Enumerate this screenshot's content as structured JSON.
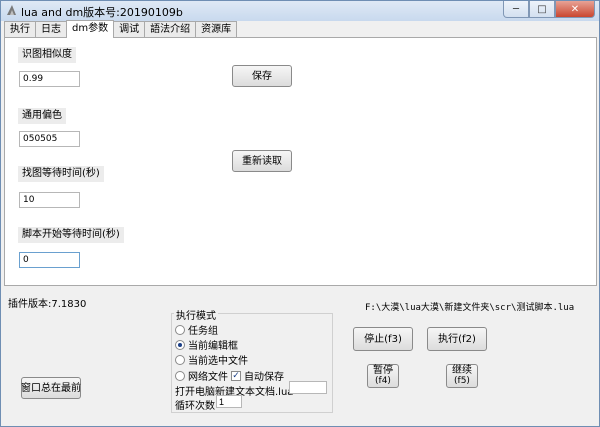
{
  "window": {
    "title": "lua and dm版本号:20190109b",
    "min_glyph": "─",
    "max_glyph": "□",
    "close_glyph": "✕"
  },
  "tabs": [
    {
      "label": "执行",
      "active": false
    },
    {
      "label": "日志",
      "active": false
    },
    {
      "label": "dm参数",
      "active": true
    },
    {
      "label": "调试",
      "active": false
    },
    {
      "label": "語法介绍",
      "active": false
    },
    {
      "label": "资源库",
      "active": false
    }
  ],
  "params": {
    "similarity_label": "识图相似度",
    "similarity_value": "0.99",
    "color_offset_label": "通用偏色",
    "color_offset_value": "050505",
    "find_wait_label": "找图等待时间(秒)",
    "find_wait_value": "10",
    "start_wait_label": "脚本开始等待时间(秒)",
    "start_wait_value": "0",
    "save_button": "保存",
    "reload_button": "重新读取"
  },
  "footer": {
    "plugin_version": "插件版本:7.1830",
    "script_path": "F:\\大漠\\lua大漠\\新建文件夹\\scr\\测试脚本.lua",
    "always_on_top_button": "窗口总在最前",
    "exec_mode_legend": "执行模式",
    "mode_task_group": "任务组",
    "mode_current_editor": "当前编辑框",
    "mode_current_file": "当前选中文件",
    "mode_web_file": "网络文件",
    "auto_save": "自动保存",
    "open_new_file_label": "打开电脑新建文本文档.lua",
    "open_new_file_value": "",
    "loop_count_label": "循环次数",
    "loop_count_value": "1",
    "stop_button": "停止(f3)",
    "run_button": "执行(f2)",
    "pause_label": "暂停",
    "pause_key": "(f4)",
    "resume_label": "继续",
    "resume_key": "(f5)"
  },
  "colors": {
    "accent": "#1b3f86",
    "titlebar": "#c8d9ee",
    "close": "#c9462f"
  }
}
